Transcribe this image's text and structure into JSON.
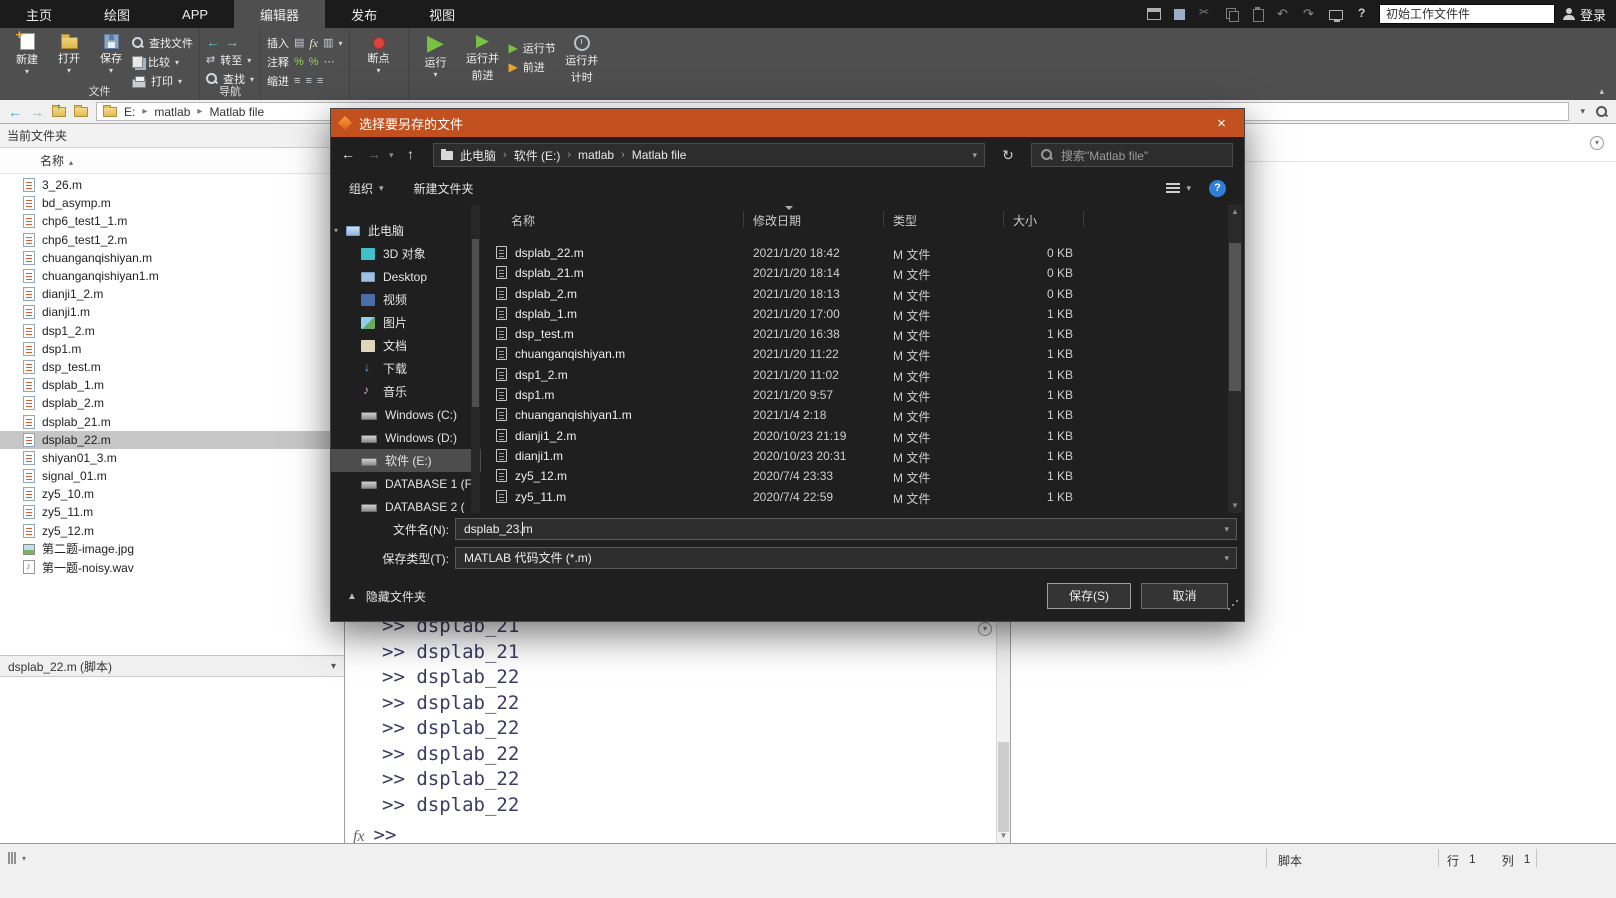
{
  "tabbar": {
    "tabs": [
      {
        "label": "主页",
        "active": false
      },
      {
        "label": "绘图",
        "active": false
      },
      {
        "label": "APP",
        "active": false
      },
      {
        "label": "编辑器",
        "active": true
      },
      {
        "label": "发布",
        "active": false
      },
      {
        "label": "视图",
        "active": false
      }
    ],
    "quick_icons": [
      "window",
      "save",
      "cut",
      "copy",
      "paste",
      "undo",
      "redo",
      "screen",
      "help"
    ],
    "search_value": "初始工作文件件",
    "login_label": "登录"
  },
  "ribbon": {
    "new": "新建",
    "open": "打开",
    "save": "保存",
    "find_files": "查找文件",
    "compare": "比较",
    "print": "打印",
    "group_file": "文件",
    "goto": "转至",
    "find": "查找",
    "group_nav": "导航",
    "insert": "插入",
    "comment": "注释",
    "indent": "缩进",
    "breakpoints": "断点",
    "run": "运行",
    "run_advance_line1": "运行并",
    "run_advance_line2": "前进",
    "run_section": "运行节",
    "advance": "前进",
    "run_time_line1": "运行并",
    "run_time_line2": "计时"
  },
  "addressbar": {
    "segments": [
      "E:",
      "matlab",
      "Matlab file"
    ]
  },
  "sidebar": {
    "title": "当前文件夹",
    "name_header": "名称",
    "files": [
      {
        "name": "3_26.m",
        "icon": "m"
      },
      {
        "name": "bd_asymp.m",
        "icon": "m"
      },
      {
        "name": "chp6_test1_1.m",
        "icon": "m"
      },
      {
        "name": "chp6_test1_2.m",
        "icon": "m"
      },
      {
        "name": "chuanganqishiyan.m",
        "icon": "m"
      },
      {
        "name": "chuanganqishiyan1.m",
        "icon": "m"
      },
      {
        "name": "dianji1_2.m",
        "icon": "m"
      },
      {
        "name": "dianji1.m",
        "icon": "m"
      },
      {
        "name": "dsp1_2.m",
        "icon": "m"
      },
      {
        "name": "dsp1.m",
        "icon": "m"
      },
      {
        "name": "dsp_test.m",
        "icon": "m"
      },
      {
        "name": "dsplab_1.m",
        "icon": "m"
      },
      {
        "name": "dsplab_2.m",
        "icon": "m"
      },
      {
        "name": "dsplab_21.m",
        "icon": "m"
      },
      {
        "name": "dsplab_22.m",
        "icon": "m",
        "selected": true
      },
      {
        "name": "shiyan01_3.m",
        "icon": "m"
      },
      {
        "name": "signal_01.m",
        "icon": "m"
      },
      {
        "name": "zy5_10.m",
        "icon": "m"
      },
      {
        "name": "zy5_11.m",
        "icon": "m"
      },
      {
        "name": "zy5_12.m",
        "icon": "m"
      },
      {
        "name": "第二题-image.jpg",
        "icon": "img"
      },
      {
        "name": "第一题-noisy.wav",
        "icon": "wav"
      }
    ],
    "details": "dsplab_22.m (脚本)"
  },
  "command_window": {
    "fx": "fx",
    "prompt": ">>",
    "lines": [
      ">> dsplab_21",
      ">> dsplab_21",
      ">> dsplab_22",
      ">> dsplab_22",
      ">> dsplab_22",
      ">> dsplab_22",
      ">> dsplab_22",
      ">> dsplab_22"
    ]
  },
  "statusbar": {
    "script_label": "脚本",
    "line_label": "行",
    "line_value": "1",
    "col_label": "列",
    "col_value": "1"
  },
  "dialog": {
    "title": "选择要另存的文件",
    "breadcrumb": [
      "此电脑",
      "软件 (E:)",
      "matlab",
      "Matlab file"
    ],
    "search_placeholder": "搜索\"Matlab file\"",
    "organize_label": "组织",
    "new_folder_label": "新建文件夹",
    "nav_items": [
      {
        "label": "此电脑",
        "icon": "pc",
        "level": 0
      },
      {
        "label": "3D 对象",
        "icon": "cube",
        "level": 1
      },
      {
        "label": "Desktop",
        "icon": "desktop",
        "level": 1
      },
      {
        "label": "视频",
        "icon": "video",
        "level": 1
      },
      {
        "label": "图片",
        "icon": "picture",
        "level": 1
      },
      {
        "label": "文档",
        "icon": "document",
        "level": 1
      },
      {
        "label": "下载",
        "icon": "download",
        "level": 1
      },
      {
        "label": "音乐",
        "icon": "music",
        "level": 1
      },
      {
        "label": "Windows (C:)",
        "icon": "drive",
        "level": 1
      },
      {
        "label": "Windows (D:)",
        "icon": "drive",
        "level": 1
      },
      {
        "label": "软件 (E:)",
        "icon": "drive",
        "level": 1,
        "selected": true
      },
      {
        "label": "DATABASE 1 (F",
        "icon": "drive",
        "level": 1
      },
      {
        "label": "DATABASE 2 (",
        "icon": "drive",
        "level": 1
      }
    ],
    "columns": [
      "名称",
      "修改日期",
      "类型",
      "大小"
    ],
    "files": [
      {
        "name": "dsplab_22.m",
        "date": "2021/1/20 18:42",
        "type": "M 文件",
        "size": "0 KB"
      },
      {
        "name": "dsplab_21.m",
        "date": "2021/1/20 18:14",
        "type": "M 文件",
        "size": "0 KB"
      },
      {
        "name": "dsplab_2.m",
        "date": "2021/1/20 18:13",
        "type": "M 文件",
        "size": "0 KB"
      },
      {
        "name": "dsplab_1.m",
        "date": "2021/1/20 17:00",
        "type": "M 文件",
        "size": "1 KB"
      },
      {
        "name": "dsp_test.m",
        "date": "2021/1/20 16:38",
        "type": "M 文件",
        "size": "1 KB"
      },
      {
        "name": "chuanganqishiyan.m",
        "date": "2021/1/20 11:22",
        "type": "M 文件",
        "size": "1 KB"
      },
      {
        "name": "dsp1_2.m",
        "date": "2021/1/20 11:02",
        "type": "M 文件",
        "size": "1 KB"
      },
      {
        "name": "dsp1.m",
        "date": "2021/1/20 9:57",
        "type": "M 文件",
        "size": "1 KB"
      },
      {
        "name": "chuanganqishiyan1.m",
        "date": "2021/1/4 2:18",
        "type": "M 文件",
        "size": "1 KB"
      },
      {
        "name": "dianji1_2.m",
        "date": "2020/10/23 21:19",
        "type": "M 文件",
        "size": "1 KB"
      },
      {
        "name": "dianji1.m",
        "date": "2020/10/23 20:31",
        "type": "M 文件",
        "size": "1 KB"
      },
      {
        "name": "zy5_12.m",
        "date": "2020/7/4 23:33",
        "type": "M 文件",
        "size": "1 KB"
      },
      {
        "name": "zy5_11.m",
        "date": "2020/7/4 22:59",
        "type": "M 文件",
        "size": "1 KB"
      }
    ],
    "filename_label": "文件名(N):",
    "filename_value": "dsplab_23.m",
    "savetype_label": "保存类型(T):",
    "savetype_value": "MATLAB 代码文件 (*.m)",
    "hide_folders_label": "隐藏文件夹",
    "save_label": "保存(S)",
    "cancel_label": "取消"
  }
}
